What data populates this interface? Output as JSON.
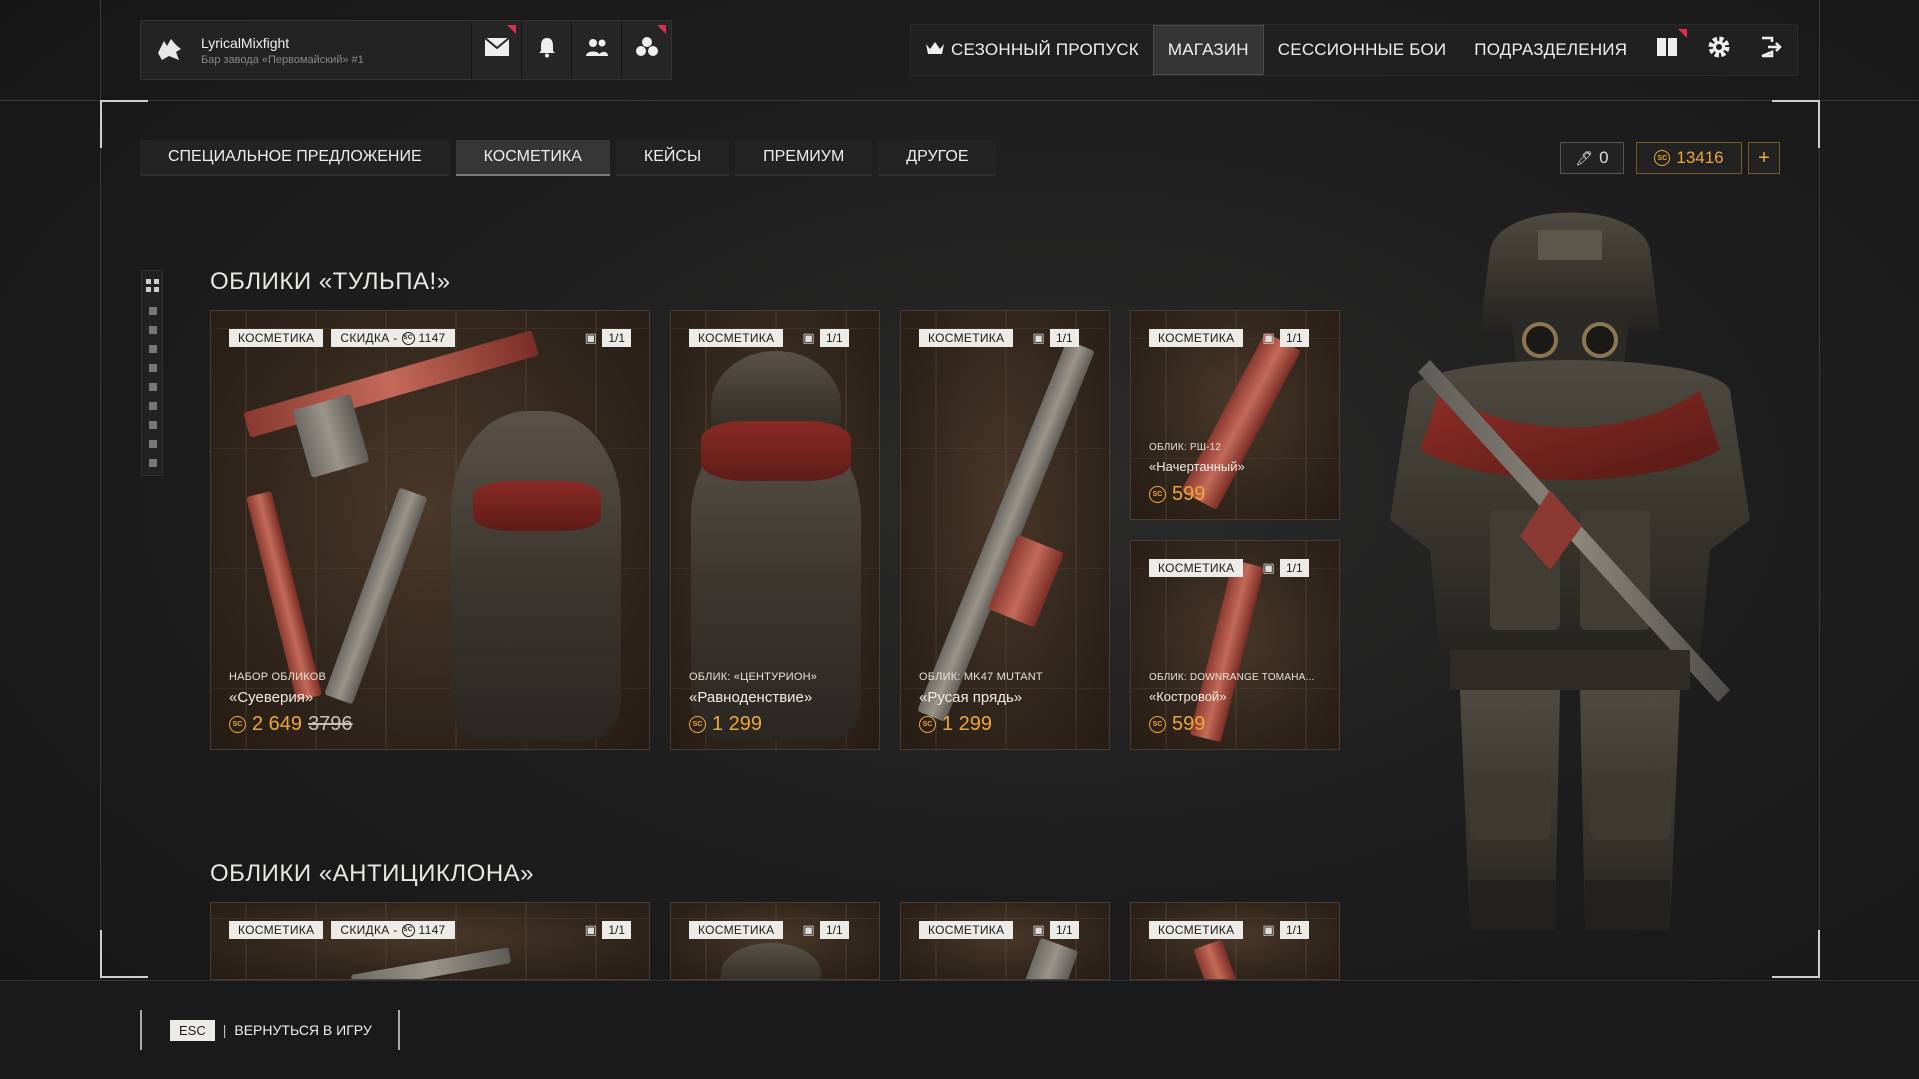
{
  "profile": {
    "username": "LyricalMixfight",
    "subtitle": "Бар завода «Первомайский» #1"
  },
  "topnav": {
    "season_pass": "СЕЗОННЫЙ ПРОПУСК",
    "shop": "МАГАЗИН",
    "session_battles": "СЕССИОННЫЕ БОИ",
    "divisions": "ПОДРАЗДЕЛЕНИЯ"
  },
  "tabs": [
    "СПЕЦИАЛЬНОЕ ПРЕДЛОЖЕНИЕ",
    "КОСМЕТИКА",
    "КЕЙСЫ",
    "ПРЕМИУМ",
    "ДРУГОЕ"
  ],
  "active_tab": "КОСМЕТИКА",
  "wallet": {
    "crowns": "0",
    "coins": "13416",
    "add": "+"
  },
  "icons": {
    "avatar": "wolf-emblem-icon",
    "mail": "mail-icon",
    "bell": "bell-icon",
    "friends": "friends-icon",
    "clans": "clan-icon",
    "season": "crown-icon",
    "book": "book-icon",
    "settings": "gear-icon",
    "exit": "logout-icon",
    "crowns": "crown-wallet-icon",
    "coin": "coin-icon",
    "box": "box-icon",
    "sections": "grid-icon"
  },
  "colors": {
    "accent": "#f0a53a",
    "flag": "#d9324a"
  },
  "sections": [
    {
      "title": "ОБЛИКИ «ТУЛЬПА!»",
      "cards": [
        {
          "tag": "КОСМЕТИКА",
          "discount": "СКИДКА -",
          "discount_value": "1147",
          "qty": "1/1",
          "sub": "НАБОР ОБЛИКОВ",
          "name": "«Суеверия»",
          "price": "2 649",
          "old_price": "3796"
        },
        {
          "tag": "КОСМЕТИКА",
          "qty": "1/1",
          "sub": "ОБЛИК: «ЦЕНТУРИОН»",
          "name": "«Равноденствие»",
          "price": "1 299"
        },
        {
          "tag": "КОСМЕТИКА",
          "qty": "1/1",
          "sub": "ОБЛИК: MK47 MUTANT",
          "name": "«Русая прядь»",
          "price": "1 299"
        },
        {
          "tag": "КОСМЕТИКА",
          "qty": "1/1",
          "sub": "ОБЛИК: РШ-12",
          "name": "«Начертанный»",
          "price": "599"
        },
        {
          "tag": "КОСМЕТИКА",
          "qty": "1/1",
          "sub": "ОБЛИК: DOWNRANGE TOMAHA...",
          "name": "«Костровой»",
          "price": "599"
        }
      ]
    },
    {
      "title": "ОБЛИКИ «АНТИЦИКЛОНА»",
      "cards": [
        {
          "tag": "КОСМЕТИКА",
          "discount": "СКИДКА -",
          "discount_value": "1147",
          "qty": "1/1"
        },
        {
          "tag": "КОСМЕТИКА",
          "qty": "1/1"
        },
        {
          "tag": "КОСМЕТИКА",
          "qty": "1/1"
        },
        {
          "tag": "КОСМЕТИКА",
          "qty": "1/1"
        }
      ]
    }
  ],
  "bottom": {
    "key": "ESC",
    "separator": "|",
    "label": "ВЕРНУТЬСЯ В ИГРУ"
  }
}
